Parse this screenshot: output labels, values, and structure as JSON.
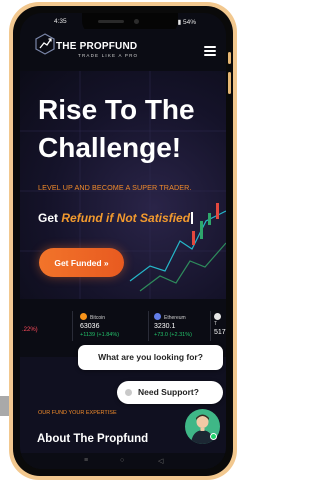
{
  "status_bar": {
    "time": "4:35",
    "indicators": "⊿ ▮ 54%"
  },
  "brand": {
    "name": "THE PROPFUND",
    "tagline": "TRADE LIKE A PRO"
  },
  "hero": {
    "title": "Rise To The Challenge!",
    "subtitle": "LEVEL UP AND BECOME A SUPER TRADER.",
    "get_prefix": "Get",
    "get_highlight": "Refund if Not Satisfied",
    "cta_label": "Get Funded »"
  },
  "ticker": [
    {
      "name": "",
      "price": "",
      "change": ".22%)",
      "direction": "down"
    },
    {
      "name": "Bitcoin",
      "price": "63036",
      "change": "+1139 (+1.84%)",
      "direction": "up",
      "color": "#f7931a"
    },
    {
      "name": "Ethereum",
      "price": "3230.1",
      "change": "+73.0 (+2.31%)",
      "direction": "up",
      "color": "#627eea"
    },
    {
      "name": "T",
      "price": "517",
      "change": "",
      "direction": "up"
    }
  ],
  "about": {
    "subheading": "OUR FUND YOUR EXPERTISE",
    "title": "About The Propfund"
  },
  "chat": {
    "question": "What are you looking for?",
    "support": "Need Support?"
  },
  "nav": {
    "menu": "≡",
    "home": "○",
    "back": "◁"
  },
  "colors": {
    "accent": "#f08a2a",
    "background": "#0b0c14",
    "positive": "#23c26b",
    "negative": "#ff4b5c",
    "shell": "#f2c88f"
  }
}
